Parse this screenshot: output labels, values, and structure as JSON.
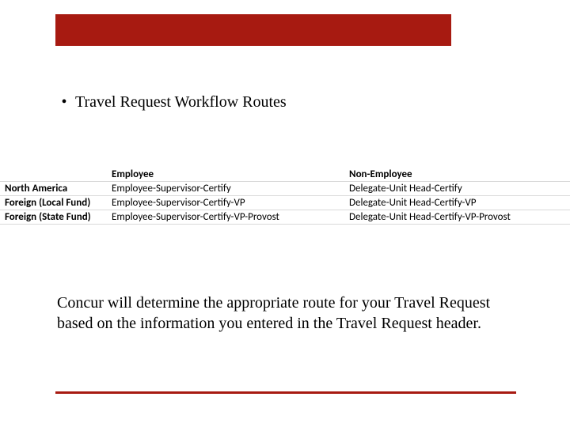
{
  "header_bar_color": "#a71a11",
  "bullet": {
    "marker": "•",
    "text": "Travel Request Workflow Routes"
  },
  "table": {
    "headers": {
      "blank": "",
      "col1": "Employee",
      "col2": "Non-Employee"
    },
    "rows": [
      {
        "label": "North America",
        "employee": "Employee-Supervisor-Certify",
        "nonemployee": "Delegate-Unit Head-Certify"
      },
      {
        "label": "Foreign (Local Fund)",
        "employee": "Employee-Supervisor-Certify-VP",
        "nonemployee": "Delegate-Unit Head-Certify-VP"
      },
      {
        "label": "Foreign (State Fund)",
        "employee": "Employee-Supervisor-Certify-VP-Provost",
        "nonemployee": "Delegate-Unit Head-Certify-VP-Provost"
      }
    ]
  },
  "body_paragraph": "Concur will determine the appropriate route for your Travel Request based on the information you entered in the Travel Request header."
}
